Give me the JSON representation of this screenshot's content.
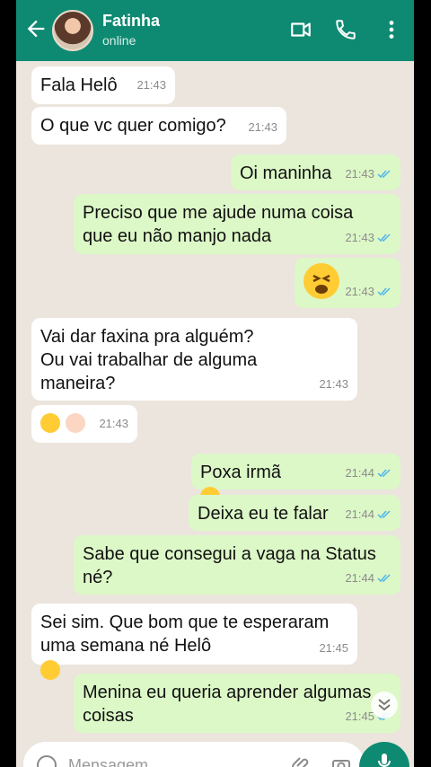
{
  "header": {
    "contact_name": "Fatinha",
    "contact_status": "online",
    "icons": [
      "back-arrow-icon",
      "video-call-icon",
      "phone-icon",
      "more-options-icon"
    ],
    "color": "#0e8a72"
  },
  "messages": [
    {
      "dir": "in",
      "text": "Fala Helô",
      "time": "21:43"
    },
    {
      "dir": "in",
      "text": "O que vc quer comigo?",
      "time": "21:43"
    },
    {
      "dir": "out",
      "text": "Oi maninha",
      "time": "21:43",
      "read": true
    },
    {
      "dir": "out",
      "text": "Preciso que me ajude numa coisa\nque eu não manjo nada",
      "time": "21:43",
      "read": true
    },
    {
      "dir": "out",
      "emoji": "tired-face",
      "time": "21:43",
      "read": true
    },
    {
      "dir": "in",
      "text": "Vai dar faxina pra alguém?\nOu vai trabalhar de alguma\nmaneira?",
      "time": "21:43"
    },
    {
      "dir": "in",
      "emoji": "grinning-sweat + woman-facepalming",
      "time": "21:43"
    },
    {
      "dir": "out",
      "text": "Poxa irmã",
      "emoji": "smiling + tired-face",
      "time": "21:44",
      "read": true
    },
    {
      "dir": "out",
      "text": "Deixa eu te falar",
      "time": "21:44",
      "read": true
    },
    {
      "dir": "out",
      "text": "Sabe que consegui a vaga na Status\nné?",
      "time": "21:44",
      "read": true
    },
    {
      "dir": "in",
      "text": "Sei sim. Que bom que te esperaram\numa semana né Helô",
      "emoji": "tired-face",
      "time": "21:45"
    },
    {
      "dir": "out",
      "text": "Menina eu queria aprender algumas\ncoisas",
      "time": "21:45",
      "read": true
    }
  ],
  "composer": {
    "placeholder": "Mensagem",
    "icons": [
      "emoji-icon",
      "attach-icon",
      "camera-icon",
      "mic-icon"
    ]
  },
  "colors": {
    "incoming": "#ffffff",
    "outgoing": "#dcf8c7",
    "chat_bg": "#ebe5dd",
    "read_ticks": "#4fb6ec"
  }
}
